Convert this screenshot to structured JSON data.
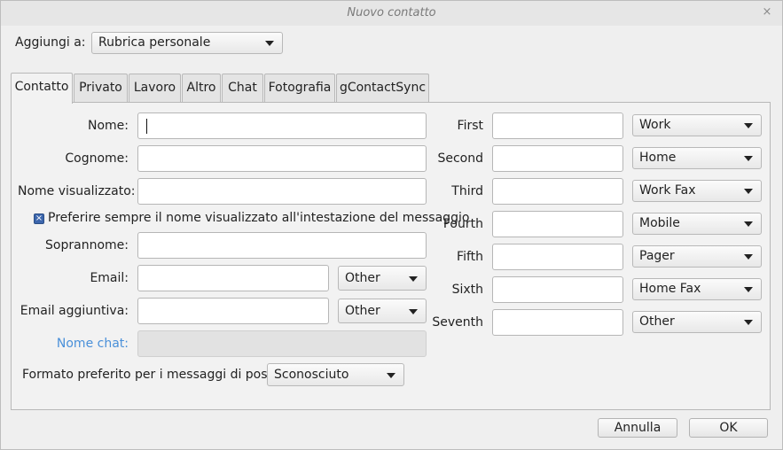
{
  "window": {
    "title": "Nuovo contatto",
    "close_glyph": "×"
  },
  "header": {
    "add_to_label": "Aggiungi a:",
    "addressbook_selected": "Rubrica personale"
  },
  "tabs": [
    "Contatto",
    "Privato",
    "Lavoro",
    "Altro",
    "Chat",
    "Fotografia",
    "gContactSync"
  ],
  "contact": {
    "first_name_label": "Nome:",
    "last_name_label": "Cognome:",
    "display_name_label": "Nome visualizzato:",
    "prefer_display_label": "Preferire sempre il nome visualizzato all'intestazione del messaggio",
    "prefer_display_checked": true,
    "nickname_label": "Soprannome:",
    "email_label": "Email:",
    "email_type": "Other",
    "email2_label": "Email aggiuntiva:",
    "email2_type": "Other",
    "chat_name_label": "Nome chat:",
    "mail_format_label": "Formato preferito per i messaggi di posta:",
    "mail_format_value": "Sconosciuto"
  },
  "phones": [
    {
      "label": "First",
      "type": "Work"
    },
    {
      "label": "Second",
      "type": "Home"
    },
    {
      "label": "Third",
      "type": "Work Fax"
    },
    {
      "label": "Fourth",
      "type": "Mobile"
    },
    {
      "label": "Fifth",
      "type": "Pager"
    },
    {
      "label": "Sixth",
      "type": "Home Fax"
    },
    {
      "label": "Seventh",
      "type": "Other"
    }
  ],
  "buttons": {
    "cancel": "Annulla",
    "ok": "OK"
  }
}
